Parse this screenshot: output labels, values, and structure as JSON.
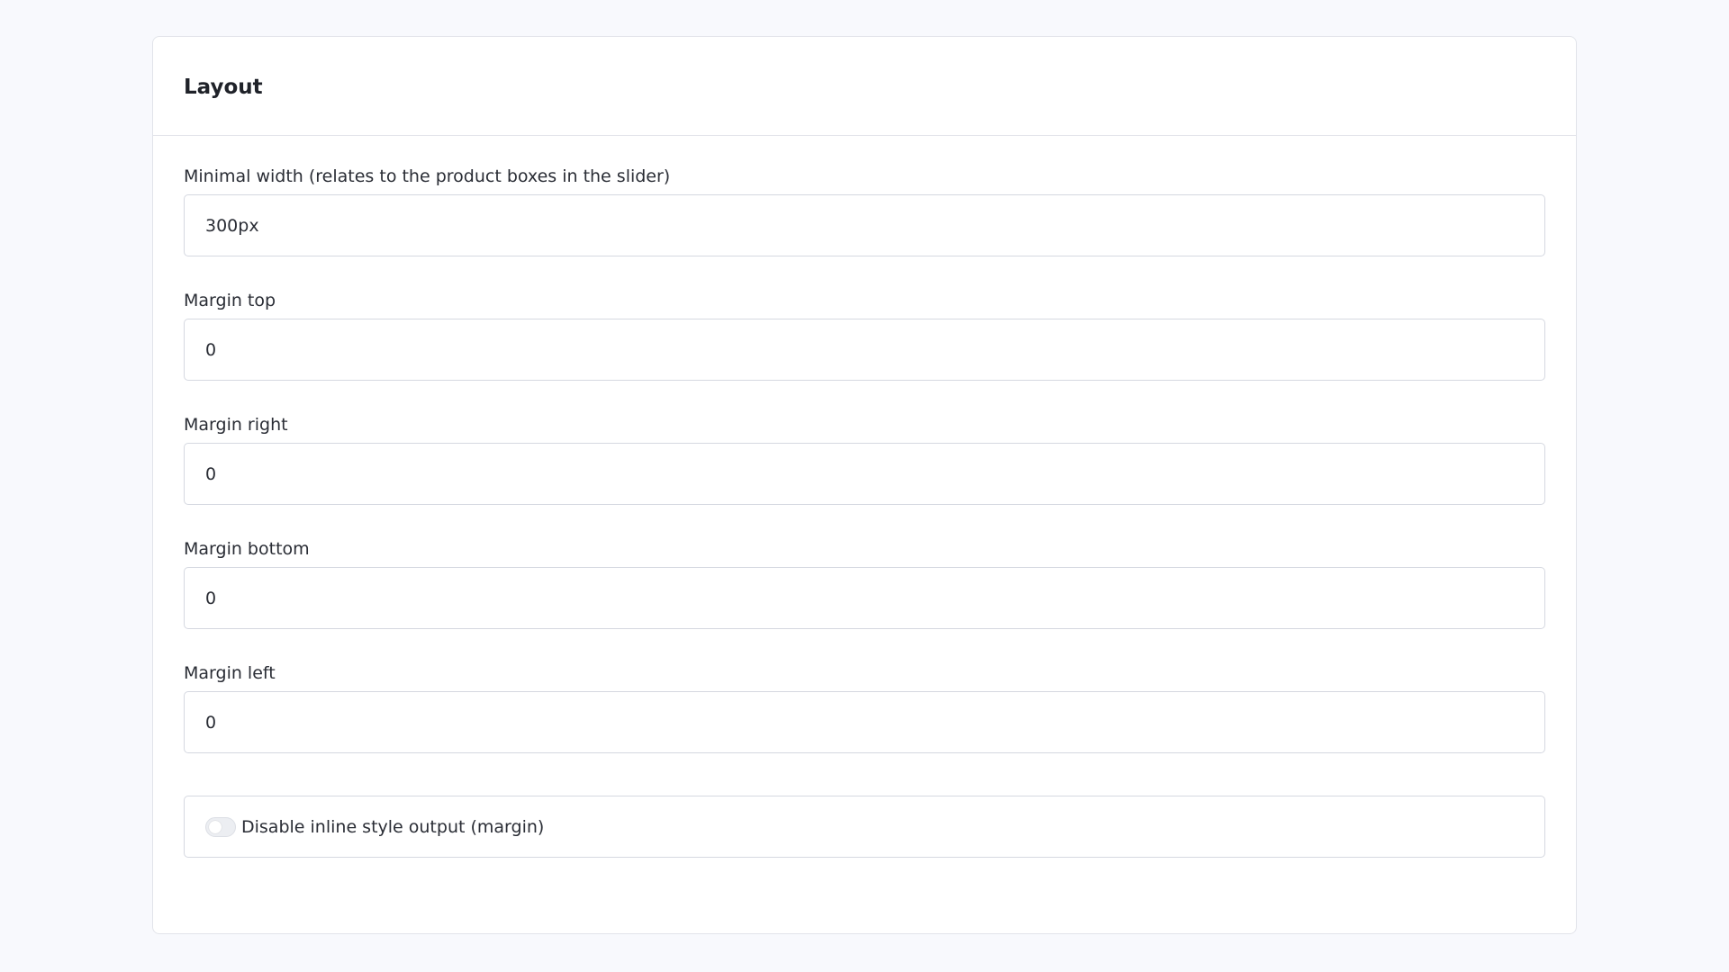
{
  "panel": {
    "title": "Layout"
  },
  "fields": {
    "min_width": {
      "label": "Minimal width (relates to the product boxes in the slider)",
      "value": "300px"
    },
    "margin_top": {
      "label": "Margin top",
      "value": "0"
    },
    "margin_right": {
      "label": "Margin right",
      "value": "0"
    },
    "margin_bottom": {
      "label": "Margin bottom",
      "value": "0"
    },
    "margin_left": {
      "label": "Margin left",
      "value": "0"
    }
  },
  "toggle": {
    "label": "Disable inline style output (margin)",
    "checked": false
  }
}
